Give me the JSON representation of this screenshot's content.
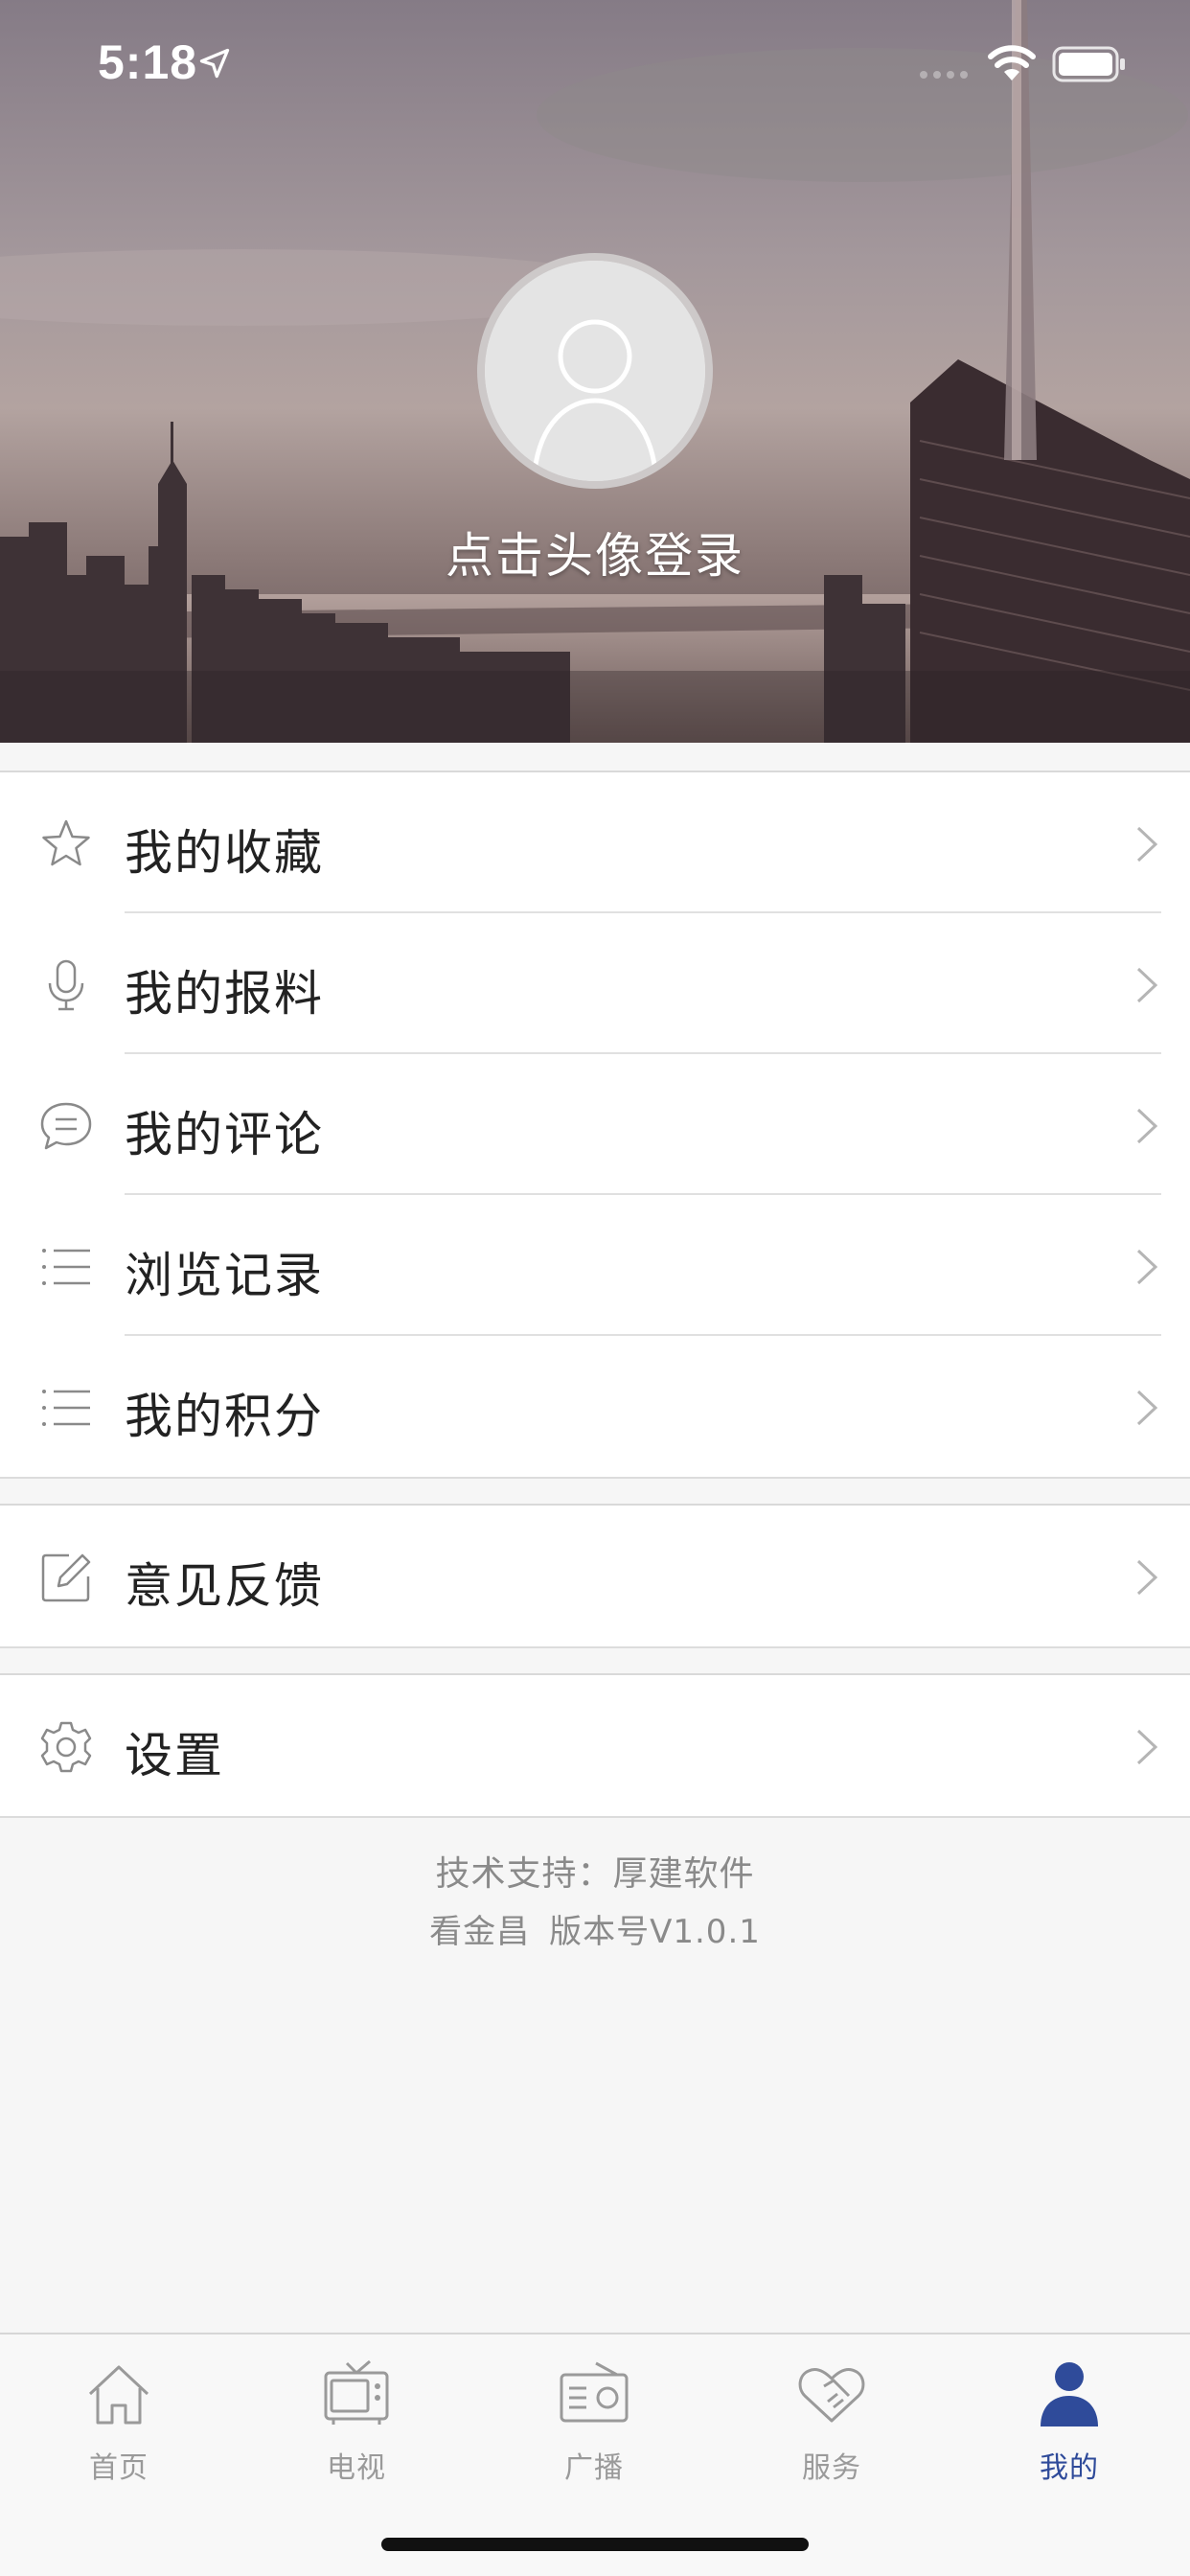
{
  "status_bar": {
    "time": "5:18",
    "icons": [
      "location-arrow-icon",
      "signal-icon",
      "wifi-icon",
      "battery-icon"
    ]
  },
  "profile": {
    "avatar_icon": "user-avatar-icon",
    "login_prompt": "点击头像登录"
  },
  "menu_groups": [
    {
      "items": [
        {
          "label": "我的收藏",
          "icon": "star-icon"
        },
        {
          "label": "我的报料",
          "icon": "microphone-icon"
        },
        {
          "label": "我的评论",
          "icon": "comment-icon"
        },
        {
          "label": "浏览记录",
          "icon": "list-icon"
        },
        {
          "label": "我的积分",
          "icon": "list-icon"
        }
      ]
    },
    {
      "items": [
        {
          "label": "意见反馈",
          "icon": "edit-icon"
        }
      ]
    },
    {
      "items": [
        {
          "label": "设置",
          "icon": "gear-icon"
        }
      ]
    }
  ],
  "footer": {
    "tech_support": "技术支持：厚建软件",
    "app_name": "看金昌",
    "version": "版本号V1.0.1"
  },
  "tabbar": {
    "active_index": 4,
    "active_color": "#2f4b9a",
    "inactive_color": "#9a9a9a",
    "tabs": [
      {
        "label": "首页",
        "icon": "home-icon"
      },
      {
        "label": "电视",
        "icon": "tv-icon"
      },
      {
        "label": "广播",
        "icon": "radio-icon"
      },
      {
        "label": "服务",
        "icon": "handshake-icon"
      },
      {
        "label": "我的",
        "icon": "person-icon"
      }
    ]
  }
}
